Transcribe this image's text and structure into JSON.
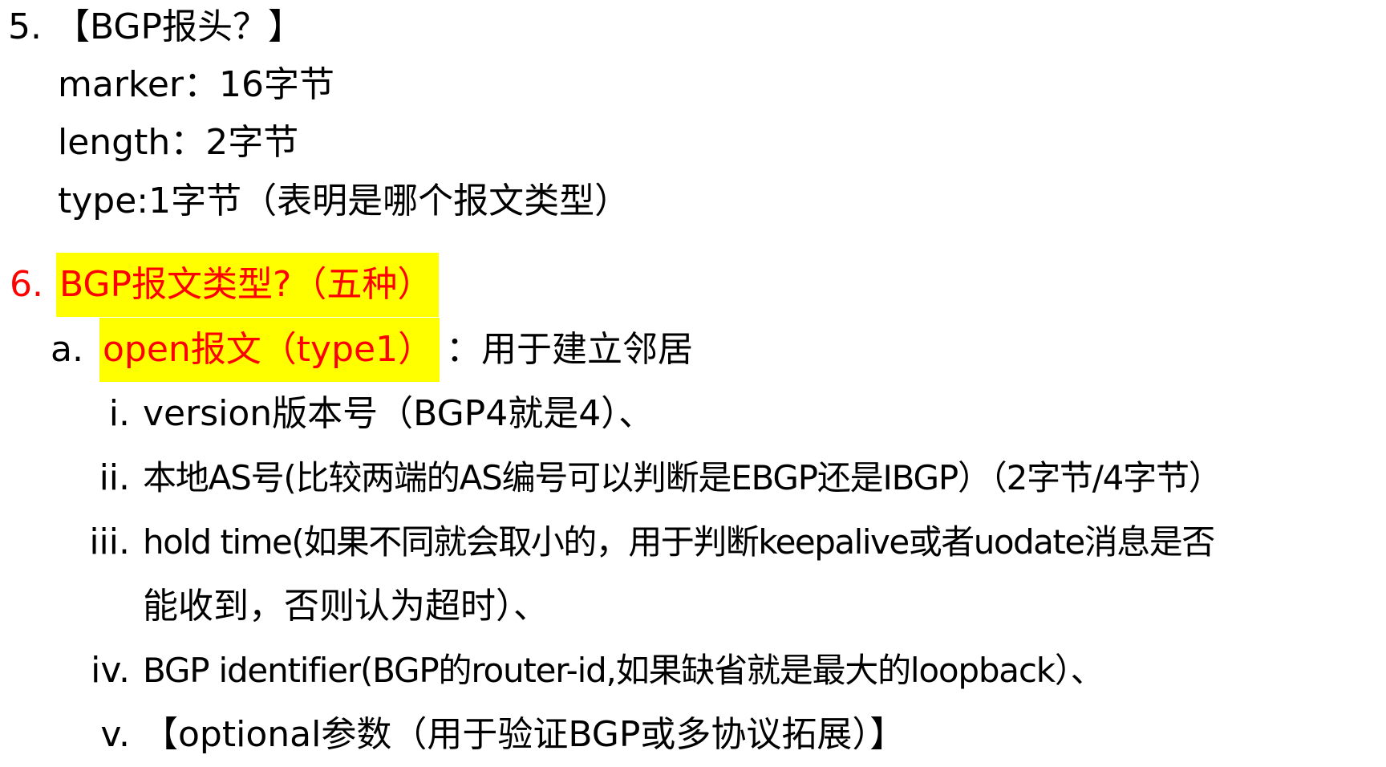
{
  "colors": {
    "highlight": "#ffff00",
    "emphasis_text": "#ff0000",
    "text": "#000000"
  },
  "item5": {
    "number": "5.",
    "title": "【BGP报头？】",
    "lines": [
      "marker：16字节",
      "length：2字节",
      "type:1字节（表明是哪个报文类型）"
    ]
  },
  "item6": {
    "number": "6.",
    "title": "BGP报文类型?（五种）",
    "sub_a": {
      "marker": "a.",
      "highlight": "open报文（type1）",
      "rest": "：用于建立邻居",
      "items": [
        {
          "marker": "i.",
          "text": "version版本号（BGP4就是4）、"
        },
        {
          "marker": "ii.",
          "text": "本地AS号(比较两端的AS编号可以判断是EBGP还是IBGP）（2字节/4字节）"
        },
        {
          "marker": "iii.",
          "text": "hold time(如果不同就会取小的，用于判断keepalive或者uodate消息是否",
          "continuation": "能收到，否则认为超时）、"
        },
        {
          "marker": "iv.",
          "text": "BGP identifier(BGP的router-id,如果缺省就是最大的loopback）、"
        },
        {
          "marker": "v.",
          "text": "【optional参数（用于验证BGP或多协议拓展）】"
        }
      ]
    }
  }
}
